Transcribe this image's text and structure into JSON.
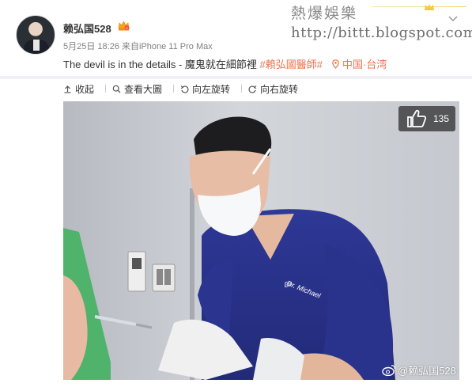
{
  "post": {
    "username": "赖弘国528",
    "date": "5月25日 18:26",
    "via_prefix": " 来自",
    "device": "iPhone 11 Pro Max",
    "text": "The devil is in the details - 魔鬼就在細節裡 ",
    "hashtag": "#賴弘國醫師#",
    "location": "中国·台湾"
  },
  "watermark": {
    "title": "熱爆娛樂",
    "url": "http://bittt.blogspot.com"
  },
  "toolbar": {
    "collapse": "收起",
    "view_large": "查看大圖",
    "rotate_left": "向左旋转",
    "rotate_right": "向右旋转"
  },
  "photo": {
    "like_count": "135",
    "credit": "@赖弘国528",
    "scrub_text_1": "Dr.",
    "scrub_text_2": "Dr. Michael"
  },
  "colors": {
    "accent": "#eb7350",
    "scrubs": "#2c3591",
    "text": "#333333",
    "meta": "#808080"
  },
  "icons": [
    "avatar",
    "vip-crown-icon",
    "chevron-down-icon",
    "collapse-icon",
    "search-icon",
    "rotate-left-icon",
    "rotate-right-icon",
    "location-pin-icon",
    "thumbs-up-icon",
    "weibo-icon"
  ]
}
